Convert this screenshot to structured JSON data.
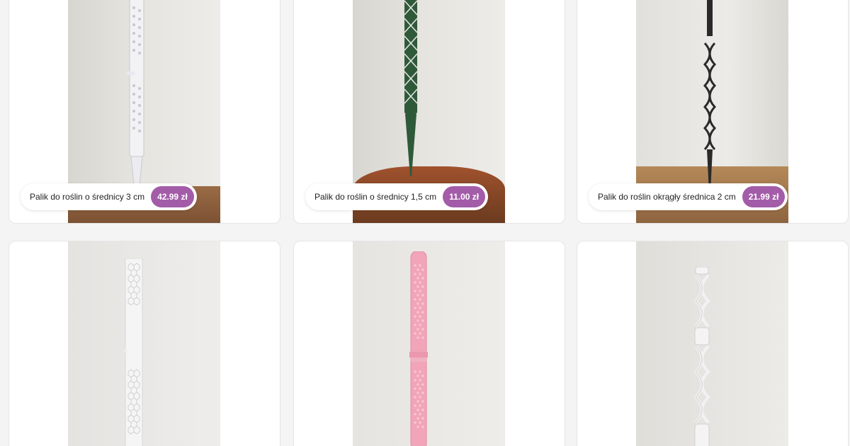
{
  "products": [
    {
      "name": "Palik do roślin o średnicy 3 cm",
      "price": "42.99 zł",
      "stake_color": "#f1f1f3",
      "pattern": "dots-white",
      "image": "white-stake-with-dots"
    },
    {
      "name": "Palik do roślin o średnicy 1,5 cm",
      "price": "11.00 zł",
      "stake_color": "#2f5a3a",
      "pattern": "green-lattice",
      "image": "green-lattice-stake"
    },
    {
      "name": "Palik do roślin okrągły średnica 2 cm",
      "price": "21.99 zł",
      "stake_color": "#2a2a2a",
      "pattern": "black-spiral",
      "image": "black-spiral-stake"
    },
    {
      "image": "white-hexagon-stake",
      "stake_color": "#f3f3f3",
      "pattern": "white-hex"
    },
    {
      "image": "pink-hexagon-stake",
      "stake_color": "#f2a5b8",
      "pattern": "pink-hex"
    },
    {
      "image": "white-helix-stake",
      "stake_color": "#f2f2f2",
      "pattern": "white-helix"
    }
  ],
  "colors": {
    "price_badge": "#a35ca8",
    "page_bg": "#f4f4f4",
    "card_bg": "#ffffff"
  }
}
